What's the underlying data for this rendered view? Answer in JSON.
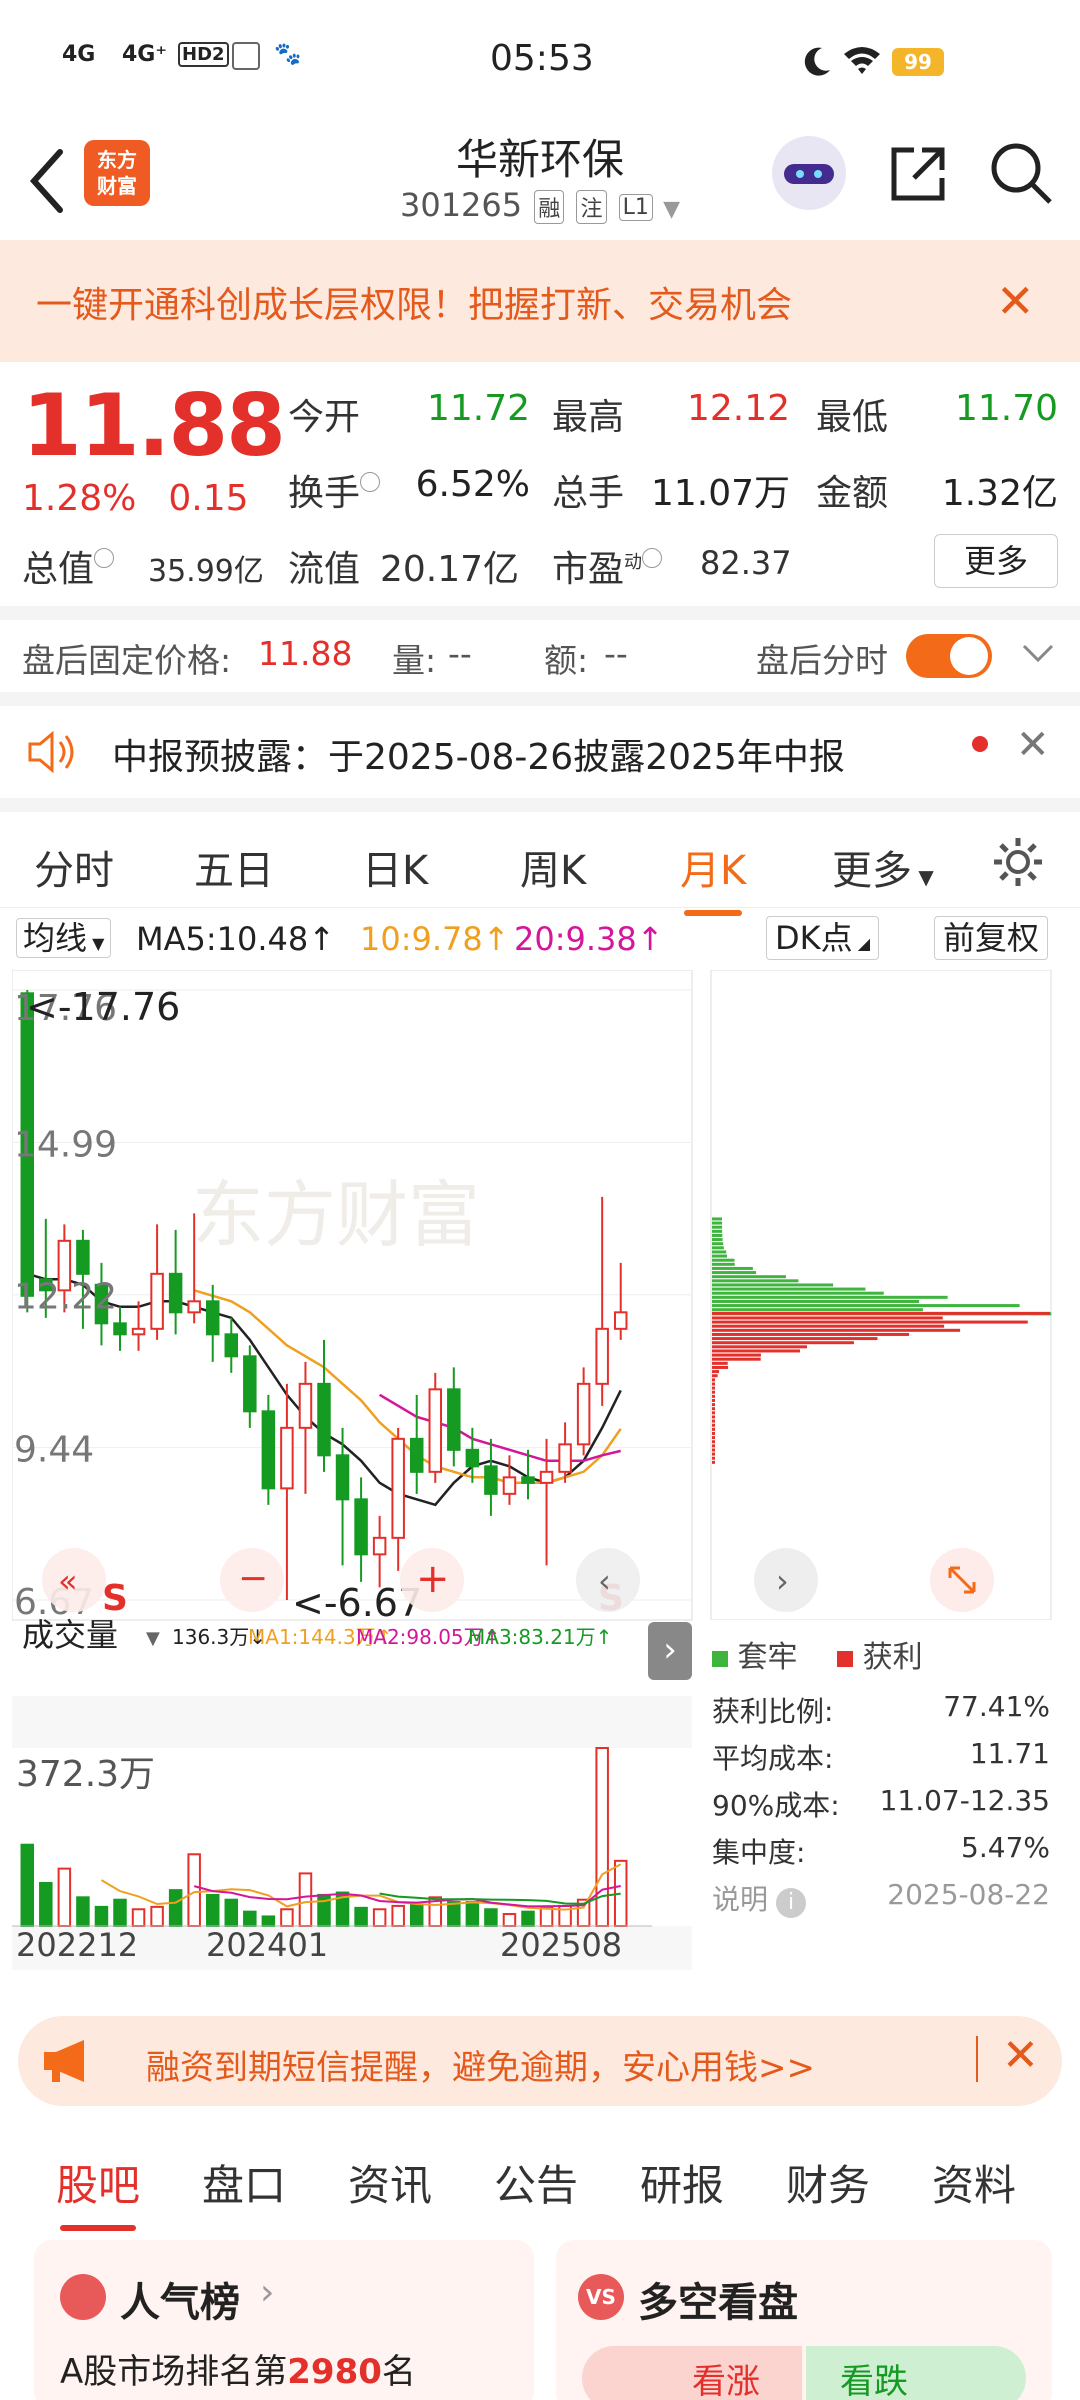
{
  "status_bar": {
    "signal1": "4G",
    "signal2": "4G⁺",
    "hd": "HD2",
    "time": "05:53",
    "battery": "99"
  },
  "header": {
    "logo_line1": "东方",
    "logo_line2": "财富",
    "stock_name": "华新环保",
    "code": "301265",
    "tag1": "融",
    "tag2": "注",
    "tag3": "L1"
  },
  "promo": {
    "text": "一键开通科创成长层权限！把握打新、交易机会"
  },
  "quote": {
    "price": "11.88",
    "change_pct": "1.28%",
    "change": "0.15",
    "open_label": "今开",
    "open": "11.72",
    "high_label": "最高",
    "high": "12.12",
    "low_label": "最低",
    "low": "11.70",
    "turnover_label": "换手",
    "turnover": "6.52%",
    "volume_label": "总手",
    "volume": "11.07万",
    "amount_label": "金额",
    "amount": "1.32亿",
    "total_value_label": "总值",
    "total_value": "35.99亿",
    "float_value_label": "流值",
    "float_value": "20.17亿",
    "pe_label": "市盈",
    "pe_sup": "动",
    "pe": "82.37",
    "more": "更多"
  },
  "after_hours": {
    "price_label": "盘后固定价格:",
    "price": "11.88",
    "vol_label": "量:",
    "vol": "--",
    "amt_label": "额:",
    "amt": "--",
    "toggle_label": "盘后分时"
  },
  "notice": {
    "text": "中报预披露：于2025-08-26披露2025年中报"
  },
  "chart_tabs": [
    "分时",
    "五日",
    "日K",
    "周K",
    "月K",
    "更多"
  ],
  "chart_tabs_active": "月K",
  "chart_toolbar": {
    "indicator": "均线",
    "ma5": "MA5:10.48↑",
    "ma10": "10:9.78↑",
    "ma20": "20:9.38↑",
    "dk": "DK点",
    "adjust": "前复权"
  },
  "kline": {
    "y_ticks": [
      "17.76",
      "14.99",
      "12.22",
      "9.44",
      "6.67"
    ],
    "max_label": "<-17.76",
    "min_label": "<-6.67",
    "watermark": "东方财富",
    "s1": "S",
    "s2": "S"
  },
  "volume_panel": {
    "selector": "成交量",
    "vol": "136.3万↓",
    "ma1": "MA1:144.3万↑",
    "ma2": "MA2:98.05万↑",
    "ma3": "MA3:83.21万↑",
    "max": "372.3万",
    "x_labels": [
      "202212",
      "202401",
      "202508"
    ]
  },
  "chips": {
    "legend_trap": "套牢",
    "legend_profit": "获利",
    "rows": [
      {
        "label": "获利比例:",
        "value": "77.41%"
      },
      {
        "label": "平均成本:",
        "value": "11.71"
      },
      {
        "label": "90%成本:",
        "value": "11.07-12.35"
      },
      {
        "label": "集中度:",
        "value": "5.47%"
      }
    ],
    "note": "说明",
    "date": "2025-08-22"
  },
  "financing_banner": {
    "text": "融资到期短信提醒，避免逾期，安心用钱>>"
  },
  "bottom_tabs": [
    "股吧",
    "盘口",
    "资讯",
    "公告",
    "研报",
    "财务",
    "资料"
  ],
  "bottom_tabs_active": "股吧",
  "cards": {
    "popularity_title": "人气榜",
    "popularity_text": "A股市场排名第",
    "popularity_rank": "2980",
    "popularity_suffix": "名",
    "vs_title": "多空看盘",
    "bull": "看涨",
    "bear": "看跌"
  },
  "colors": {
    "red": "#e4302b",
    "green": "#159a22",
    "orange": "#f36b18",
    "ma10": "#f0a020",
    "ma20": "#d4169a"
  },
  "chart_data": {
    "type": "candlestick",
    "period": "monthly",
    "ylim": [
      6.67,
      17.76
    ],
    "candles": [
      {
        "o": 17.7,
        "c": 12.2,
        "h": 17.76,
        "l": 11.9
      },
      {
        "o": 12.5,
        "c": 12.3,
        "h": 13.6,
        "l": 11.8
      },
      {
        "o": 12.3,
        "c": 13.2,
        "h": 13.5,
        "l": 11.9
      },
      {
        "o": 13.2,
        "c": 12.6,
        "h": 13.4,
        "l": 11.6
      },
      {
        "o": 12.4,
        "c": 11.7,
        "h": 12.8,
        "l": 11.3
      },
      {
        "o": 11.7,
        "c": 11.5,
        "h": 12.0,
        "l": 11.2
      },
      {
        "o": 11.5,
        "c": 11.6,
        "h": 12.1,
        "l": 11.2
      },
      {
        "o": 11.6,
        "c": 12.6,
        "h": 13.5,
        "l": 11.4
      },
      {
        "o": 12.6,
        "c": 11.9,
        "h": 13.4,
        "l": 11.5
      },
      {
        "o": 11.9,
        "c": 12.1,
        "h": 13.7,
        "l": 11.7
      },
      {
        "o": 12.1,
        "c": 11.5,
        "h": 12.4,
        "l": 11.0
      },
      {
        "o": 11.5,
        "c": 11.1,
        "h": 11.8,
        "l": 10.8
      },
      {
        "o": 11.1,
        "c": 10.1,
        "h": 11.3,
        "l": 9.8
      },
      {
        "o": 10.1,
        "c": 8.7,
        "h": 10.4,
        "l": 8.4
      },
      {
        "o": 8.7,
        "c": 9.8,
        "h": 10.6,
        "l": 6.67
      },
      {
        "o": 9.8,
        "c": 10.6,
        "h": 11.0,
        "l": 8.6
      },
      {
        "o": 10.6,
        "c": 9.3,
        "h": 11.4,
        "l": 9.0
      },
      {
        "o": 9.3,
        "c": 8.5,
        "h": 9.8,
        "l": 7.3
      },
      {
        "o": 8.5,
        "c": 7.5,
        "h": 8.9,
        "l": 7.0
      },
      {
        "o": 7.5,
        "c": 7.8,
        "h": 8.2,
        "l": 6.9
      },
      {
        "o": 7.8,
        "c": 9.6,
        "h": 9.8,
        "l": 7.2
      },
      {
        "o": 9.6,
        "c": 9.0,
        "h": 10.4,
        "l": 8.6
      },
      {
        "o": 9.0,
        "c": 10.5,
        "h": 10.8,
        "l": 8.8
      },
      {
        "o": 10.5,
        "c": 9.4,
        "h": 10.9,
        "l": 9.1
      },
      {
        "o": 9.4,
        "c": 9.1,
        "h": 9.8,
        "l": 8.8
      },
      {
        "o": 9.1,
        "c": 8.6,
        "h": 9.6,
        "l": 8.2
      },
      {
        "o": 8.6,
        "c": 8.9,
        "h": 9.3,
        "l": 8.4
      },
      {
        "o": 8.9,
        "c": 8.8,
        "h": 9.4,
        "l": 8.5
      },
      {
        "o": 8.8,
        "c": 9.0,
        "h": 9.6,
        "l": 7.3
      },
      {
        "o": 9.0,
        "c": 9.5,
        "h": 9.9,
        "l": 8.8
      },
      {
        "o": 9.5,
        "c": 10.6,
        "h": 10.9,
        "l": 9.3
      },
      {
        "o": 10.6,
        "c": 11.6,
        "h": 14.0,
        "l": 10.2
      },
      {
        "o": 11.6,
        "c": 11.9,
        "h": 12.8,
        "l": 11.4
      }
    ],
    "ma5": [
      12.6,
      12.5,
      12.5,
      12.4,
      12.1,
      12.0,
      12.0,
      12.1,
      12.1,
      12.0,
      11.9,
      11.8,
      11.4,
      10.9,
      10.4,
      10.0,
      9.7,
      9.5,
      9.2,
      8.8,
      8.6,
      8.5,
      8.4,
      8.8,
      9.1,
      9.2,
      9.1,
      8.9,
      8.8,
      8.9,
      9.2,
      9.8,
      10.48
    ],
    "ma10": [
      null,
      null,
      null,
      null,
      null,
      null,
      null,
      null,
      null,
      12.3,
      12.2,
      12.1,
      11.9,
      11.6,
      11.3,
      11.1,
      10.9,
      10.6,
      10.3,
      9.9,
      9.6,
      9.3,
      9.1,
      9.0,
      8.9,
      8.9,
      8.8,
      8.8,
      8.8,
      8.9,
      9.0,
      9.3,
      9.78
    ],
    "ma20": [
      null,
      null,
      null,
      null,
      null,
      null,
      null,
      null,
      null,
      null,
      null,
      null,
      null,
      null,
      null,
      null,
      null,
      null,
      null,
      10.4,
      10.2,
      10.0,
      9.9,
      9.8,
      9.6,
      9.5,
      9.4,
      9.3,
      9.2,
      9.2,
      9.2,
      9.3,
      9.38
    ],
    "volume": [
      170,
      90,
      120,
      60,
      40,
      55,
      35,
      40,
      75,
      150,
      65,
      55,
      30,
      20,
      35,
      110,
      65,
      70,
      38,
      35,
      42,
      45,
      60,
      50,
      50,
      35,
      25,
      30,
      40,
      42,
      55,
      372.3,
      136.3
    ],
    "volume_ylim": [
      0,
      372.3
    ]
  }
}
